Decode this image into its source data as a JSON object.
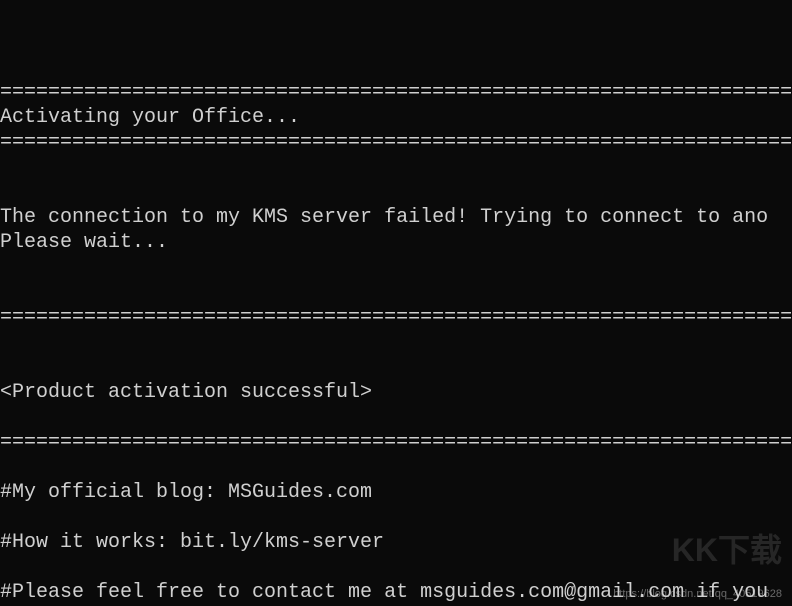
{
  "terminal": {
    "blank1": "",
    "blank2": "",
    "blank3": "",
    "divider1": "============================================================================",
    "title": "Activating your Office...",
    "divider2": "============================================================================",
    "blank4": "",
    "blank5": "",
    "msg1": "The connection to my KMS server failed! Trying to connect to ano",
    "msg2": "Please wait...",
    "blank6": "",
    "blank7": "",
    "divider3": "============================================================================",
    "blank8": "",
    "blank9": "",
    "result": "<Product activation successful>",
    "blank10": "",
    "divider4": "============================================================================",
    "blank11": "",
    "info1": "#My official blog: MSGuides.com",
    "blank12": "",
    "info2": "#How it works: bit.ly/kms-server",
    "blank13": "",
    "info3": "#Please feel free to contact me at msguides.com@gmail.com if you"
  },
  "watermark": "KK下载",
  "footer_url": "https://blog.csdn.net/qq_40519628"
}
